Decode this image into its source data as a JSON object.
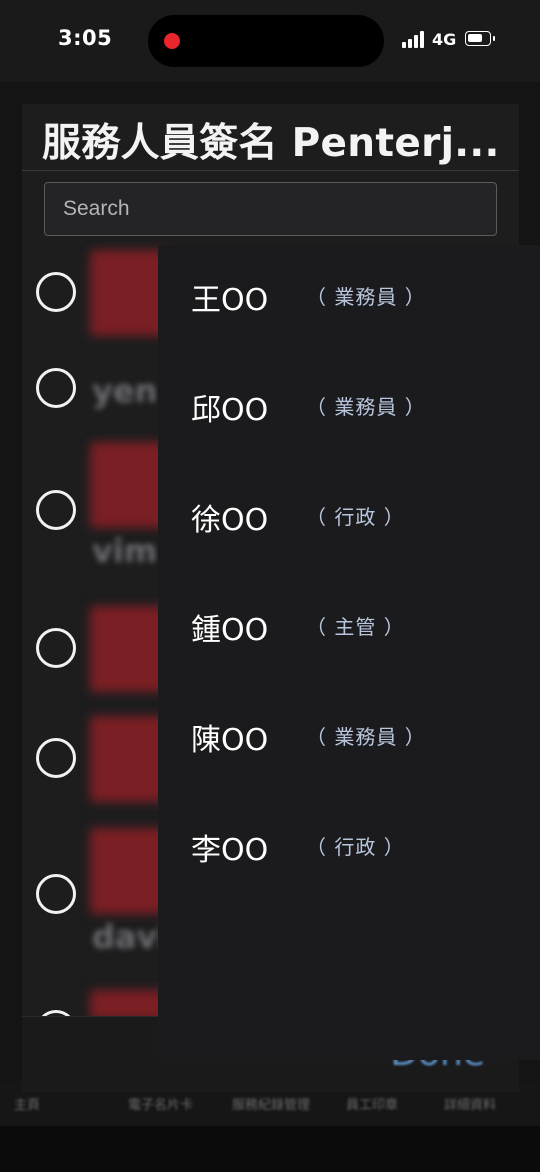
{
  "status_bar": {
    "time": "3:05",
    "network": "4G"
  },
  "modal": {
    "title": "服務人員簽名 Penterj...",
    "search_placeholder": "Search",
    "underlying_names": [
      "yen",
      "vim",
      "davi"
    ],
    "done_label": "Done"
  },
  "staff_list": [
    {
      "name": "王OO",
      "role": "（ 業務員 ）"
    },
    {
      "name": "邱OO",
      "role": "（ 業務員 ）"
    },
    {
      "name": "徐OO",
      "role": "（ 行政 ）"
    },
    {
      "name": "鍾OO",
      "role": "（ 主管 ）"
    },
    {
      "name": "陳OO",
      "role": "（ 業務員 ）"
    },
    {
      "name": "李OO",
      "role": "（ 行政 ）"
    }
  ],
  "bottom_tabs": [
    "主頁",
    "電子名片卡",
    "服務紀錄管理",
    "員工印章",
    "詳細資料"
  ],
  "colors": {
    "popup_bg": "#1b1b1d",
    "role_text": "#b8c6dd",
    "done_blue": "#5a8fc2",
    "recording_dot": "#e8262b"
  }
}
